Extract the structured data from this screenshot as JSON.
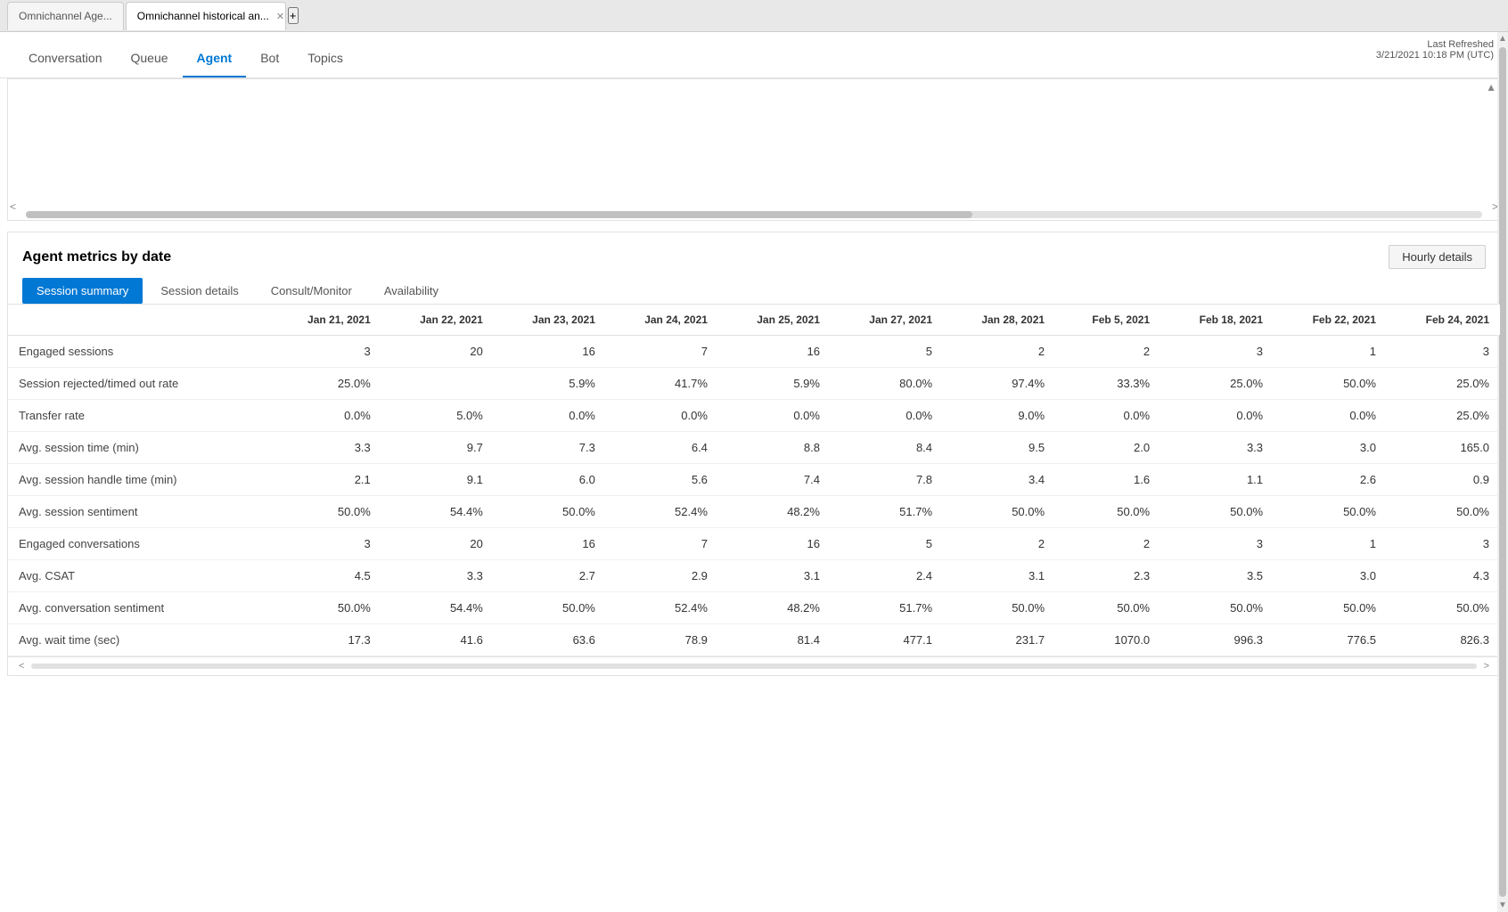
{
  "browser": {
    "tab1_label": "Omnichannel Age...",
    "tab2_label": "Omnichannel historical an...",
    "new_tab_label": "+"
  },
  "nav": {
    "items": [
      {
        "id": "conversation",
        "label": "Conversation"
      },
      {
        "id": "queue",
        "label": "Queue"
      },
      {
        "id": "agent",
        "label": "Agent"
      },
      {
        "id": "bot",
        "label": "Bot"
      },
      {
        "id": "topics",
        "label": "Topics"
      }
    ],
    "active": "agent",
    "last_refreshed_label": "Last Refreshed",
    "last_refreshed_value": "3/21/2021 10:18 PM (UTC)"
  },
  "panel": {
    "title": "Agent metrics by date",
    "hourly_details_label": "Hourly details",
    "sub_tabs": [
      {
        "id": "session_summary",
        "label": "Session summary",
        "active": true
      },
      {
        "id": "session_details",
        "label": "Session details"
      },
      {
        "id": "consult_monitor",
        "label": "Consult/Monitor"
      },
      {
        "id": "availability",
        "label": "Availability"
      }
    ]
  },
  "table": {
    "columns": [
      "",
      "Jan 21, 2021",
      "Jan 22, 2021",
      "Jan 23, 2021",
      "Jan 24, 2021",
      "Jan 25, 2021",
      "Jan 27, 2021",
      "Jan 28, 2021",
      "Feb 5, 2021",
      "Feb 18, 2021",
      "Feb 22, 2021",
      "Feb 24, 2021"
    ],
    "rows": [
      {
        "label": "Engaged sessions",
        "values": [
          "3",
          "20",
          "16",
          "7",
          "16",
          "5",
          "2",
          "2",
          "3",
          "1",
          "3"
        ]
      },
      {
        "label": "Session rejected/timed out rate",
        "values": [
          "25.0%",
          "",
          "5.9%",
          "41.7%",
          "5.9%",
          "80.0%",
          "97.4%",
          "33.3%",
          "25.0%",
          "50.0%",
          "25.0%"
        ]
      },
      {
        "label": "Transfer rate",
        "values": [
          "0.0%",
          "5.0%",
          "0.0%",
          "0.0%",
          "0.0%",
          "0.0%",
          "9.0%",
          "0.0%",
          "0.0%",
          "0.0%",
          "25.0%"
        ]
      },
      {
        "label": "Avg. session time (min)",
        "values": [
          "3.3",
          "9.7",
          "7.3",
          "6.4",
          "8.8",
          "8.4",
          "9.5",
          "2.0",
          "3.3",
          "3.0",
          "165.0"
        ]
      },
      {
        "label": "Avg. session handle time (min)",
        "values": [
          "2.1",
          "9.1",
          "6.0",
          "5.6",
          "7.4",
          "7.8",
          "3.4",
          "1.6",
          "1.1",
          "2.6",
          "0.9"
        ]
      },
      {
        "label": "Avg. session sentiment",
        "values": [
          "50.0%",
          "54.4%",
          "50.0%",
          "52.4%",
          "48.2%",
          "51.7%",
          "50.0%",
          "50.0%",
          "50.0%",
          "50.0%",
          "50.0%"
        ]
      },
      {
        "label": "Engaged conversations",
        "values": [
          "3",
          "20",
          "16",
          "7",
          "16",
          "5",
          "2",
          "2",
          "3",
          "1",
          "3"
        ]
      },
      {
        "label": "Avg. CSAT",
        "values": [
          "4.5",
          "3.3",
          "2.7",
          "2.9",
          "3.1",
          "2.4",
          "3.1",
          "2.3",
          "3.5",
          "3.0",
          "4.3"
        ]
      },
      {
        "label": "Avg. conversation sentiment",
        "values": [
          "50.0%",
          "54.4%",
          "50.0%",
          "52.4%",
          "48.2%",
          "51.7%",
          "50.0%",
          "50.0%",
          "50.0%",
          "50.0%",
          "50.0%"
        ]
      },
      {
        "label": "Avg. wait time (sec)",
        "values": [
          "17.3",
          "41.6",
          "63.6",
          "78.9",
          "81.4",
          "477.1",
          "231.7",
          "1070.0",
          "996.3",
          "776.5",
          "826.3"
        ]
      }
    ]
  }
}
